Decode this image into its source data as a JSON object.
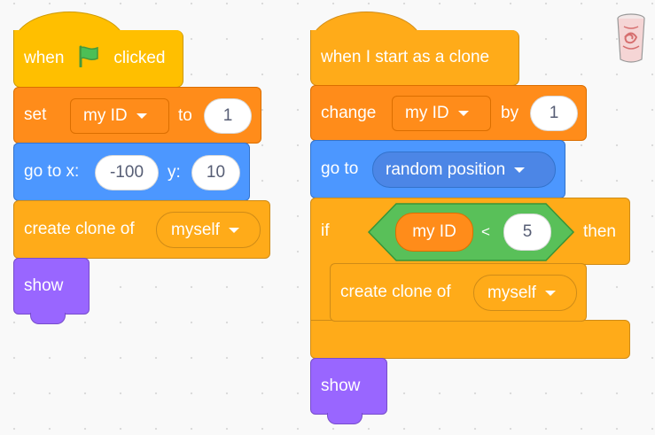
{
  "script1": {
    "hat": {
      "when": "when",
      "clicked": "clicked",
      "flag_icon": "green-flag-icon"
    },
    "set": {
      "label": "set",
      "var": "my ID",
      "to": "to",
      "value": "1"
    },
    "goto": {
      "label": "go to x:",
      "x": "-100",
      "ylabel": "y:",
      "y": "10"
    },
    "clone": {
      "label": "create clone of",
      "target": "myself"
    },
    "show": {
      "label": "show"
    }
  },
  "script2": {
    "hat": {
      "label": "when I start as a clone"
    },
    "change": {
      "label": "change",
      "var": "my ID",
      "by": "by",
      "value": "1"
    },
    "goto": {
      "label": "go to",
      "target": "random position"
    },
    "if": {
      "label": "if",
      "then": "then",
      "left": "my ID",
      "op": "<",
      "right": "5"
    },
    "clone": {
      "label": "create clone of",
      "target": "myself"
    },
    "show": {
      "label": "show"
    }
  },
  "colors": {
    "events": "#ffbf00",
    "variables": "#ff8c1a",
    "motion": "#4c97ff",
    "control": "#ffab19",
    "looks": "#9966ff",
    "operators": "#59c059"
  },
  "icons": {
    "trash": "trash-can-icon"
  }
}
